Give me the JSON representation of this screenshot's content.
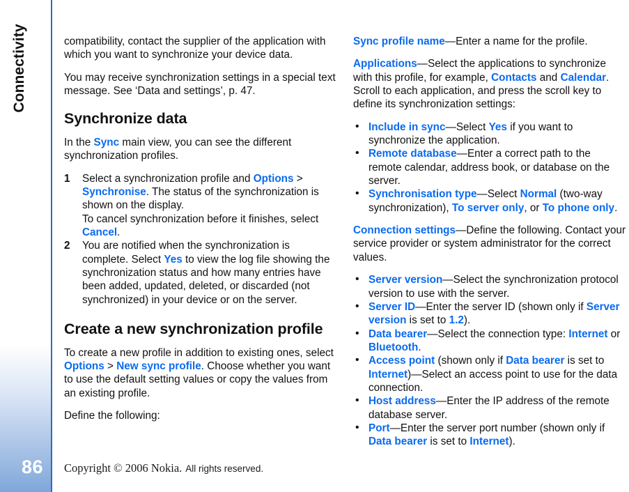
{
  "page": {
    "chapter_tab": "Connectivity",
    "page_number": "86",
    "footer": {
      "copyright_serif": "Copyright © 2006 Nokia.",
      "rights_sans": "All rights reserved."
    },
    "accent_color": "#0b6bee",
    "sidebar_gradient_end": "#7ea7da",
    "rule_color": "#2f6db5"
  },
  "left_column": {
    "para_compatibility": {
      "t1": "compatibility, contact the supplier of the application with which you want to synchronize your device data."
    },
    "para_settings_message": {
      "t1": "You may receive synchronization settings in a special text message. See ‘Data and settings’, p. 47."
    },
    "heading_synchronize_data": "Synchronize data",
    "para_sync_mainview": {
      "t1": "In the ",
      "ui1": "Sync",
      "t2": " main view, you can see the different synchronization profiles."
    },
    "steps": [
      {
        "num": "1",
        "t1": "Select a synchronization profile and ",
        "ui1": "Options",
        "gt": " > ",
        "ui2": "Synchronise",
        "t2": ". The status of the synchronization is shown on the display.",
        "t3": "To cancel synchronization before it finishes, select ",
        "ui3": "Cancel",
        "t4": "."
      },
      {
        "num": "2",
        "t1": "You are notified when the synchronization is complete. Select ",
        "ui1": "Yes",
        "t2": " to view the log file showing the synchronization status and how many entries have been added, updated, deleted, or discarded (not synchronized) in your device or on the server."
      }
    ],
    "heading_create_profile": "Create a new synchronization profile",
    "para_create_profile": {
      "t1": "To create a new profile in addition to existing ones, select ",
      "ui1": "Options",
      "gt": " > ",
      "ui2": "New sync profile",
      "t2": ". Choose whether you want to use the default setting values or copy the values from an existing profile."
    },
    "para_define": "Define the following:"
  },
  "right_column": {
    "para_sync_profile_name": {
      "ui1": "Sync profile name",
      "t1": "—Enter a name for the profile."
    },
    "para_applications": {
      "ui1": "Applications",
      "t1": "—Select the applications to synchronize with this profile, for example, ",
      "ui2": "Contacts",
      "t2": " and ",
      "ui3": "Calendar",
      "t3": ". Scroll to each application, and press the scroll key to define its synchronization settings:"
    },
    "app_settings_bullets": [
      {
        "ui1": "Include in sync",
        "t1": "—Select ",
        "ui2": "Yes",
        "t2": " if you want to synchronize the application."
      },
      {
        "ui1": "Remote database",
        "t1": "—Enter a correct path to the remote calendar, address book, or database on the server."
      },
      {
        "ui1": "Synchronisation type",
        "t1": "—Select ",
        "ui2": "Normal",
        "t2": " (two-way synchronization), ",
        "ui3": "To server only",
        "t3": ", or ",
        "ui4": "To phone only",
        "t4": "."
      }
    ],
    "para_connection_settings": {
      "ui1": "Connection settings",
      "t1": "—Define the following. Contact your service provider or system administrator for the correct values."
    },
    "connection_bullets": [
      {
        "ui1": "Server version",
        "t1": "—Select the synchronization protocol version to use with the server."
      },
      {
        "ui1": "Server ID",
        "t1": "—Enter the server ID (shown only if ",
        "ui2": "Server version",
        "t2": " is set to ",
        "ui3": "1.2",
        "t3": ")."
      },
      {
        "ui1": "Data bearer",
        "t1": "—Select the connection type: ",
        "ui2": "Internet",
        "t2": " or ",
        "ui3": "Bluetooth",
        "t3": "."
      },
      {
        "ui1": "Access point",
        "t1": " (shown only if ",
        "ui2": "Data bearer",
        "t2": " is set to ",
        "ui3": "Internet",
        "t3": ")—Select an access point to use for the data connection."
      },
      {
        "ui1": "Host address",
        "t1": "—Enter the IP address of the remote database server."
      },
      {
        "ui1": "Port",
        "t1": "—Enter the server port number (shown only if ",
        "ui2": "Data bearer",
        "t2": " is set to ",
        "ui3": "Internet",
        "t3": ")."
      }
    ]
  }
}
